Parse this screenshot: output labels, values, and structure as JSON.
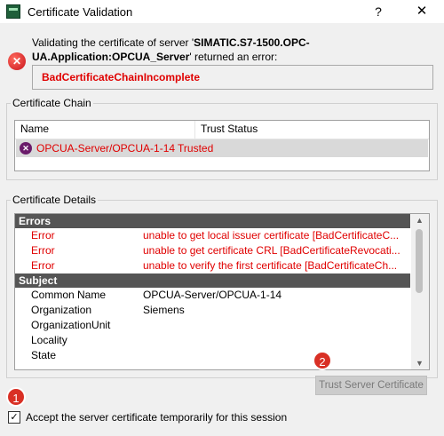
{
  "window": {
    "title": "Certificate Validation",
    "help_label": "?",
    "close_label": "✕"
  },
  "message": {
    "prefix": "Validating the certificate of server '",
    "server": "SIMATIC.S7-1500.OPC-UA.Application:OPCUA_Server",
    "suffix": "' returned an error:",
    "error_code": "BadCertificateChainIncomplete"
  },
  "chain": {
    "legend": "Certificate Chain",
    "columns": [
      "Name",
      "Trust Status"
    ],
    "rows": [
      {
        "name": "OPCUA-Server/OPCUA-1-14",
        "status": "Trusted"
      }
    ]
  },
  "details": {
    "legend": "Certificate Details",
    "errors_header": "Errors",
    "errors": [
      {
        "k": "Error",
        "v": "unable to get local issuer certificate [BadCertificateC..."
      },
      {
        "k": "Error",
        "v": "unable to get certificate CRL [BadCertificateRevocati..."
      },
      {
        "k": "Error",
        "v": "unable to verify the first certificate [BadCertificateCh..."
      }
    ],
    "subject_header": "Subject",
    "subject": [
      {
        "k": "Common Name",
        "v": "OPCUA-Server/OPCUA-1-14"
      },
      {
        "k": "Organization",
        "v": "Siemens"
      },
      {
        "k": "OrganizationUnit",
        "v": ""
      },
      {
        "k": "Locality",
        "v": ""
      },
      {
        "k": "State",
        "v": ""
      }
    ]
  },
  "trust_button": "Trust Server Certificate",
  "badges": {
    "one": "1",
    "two": "2"
  },
  "accept": {
    "checked": true,
    "label": "Accept the server certificate temporarily for this session"
  },
  "colors": {
    "error": "#e00000",
    "section_header": "#555555",
    "badge": "#d93025"
  }
}
